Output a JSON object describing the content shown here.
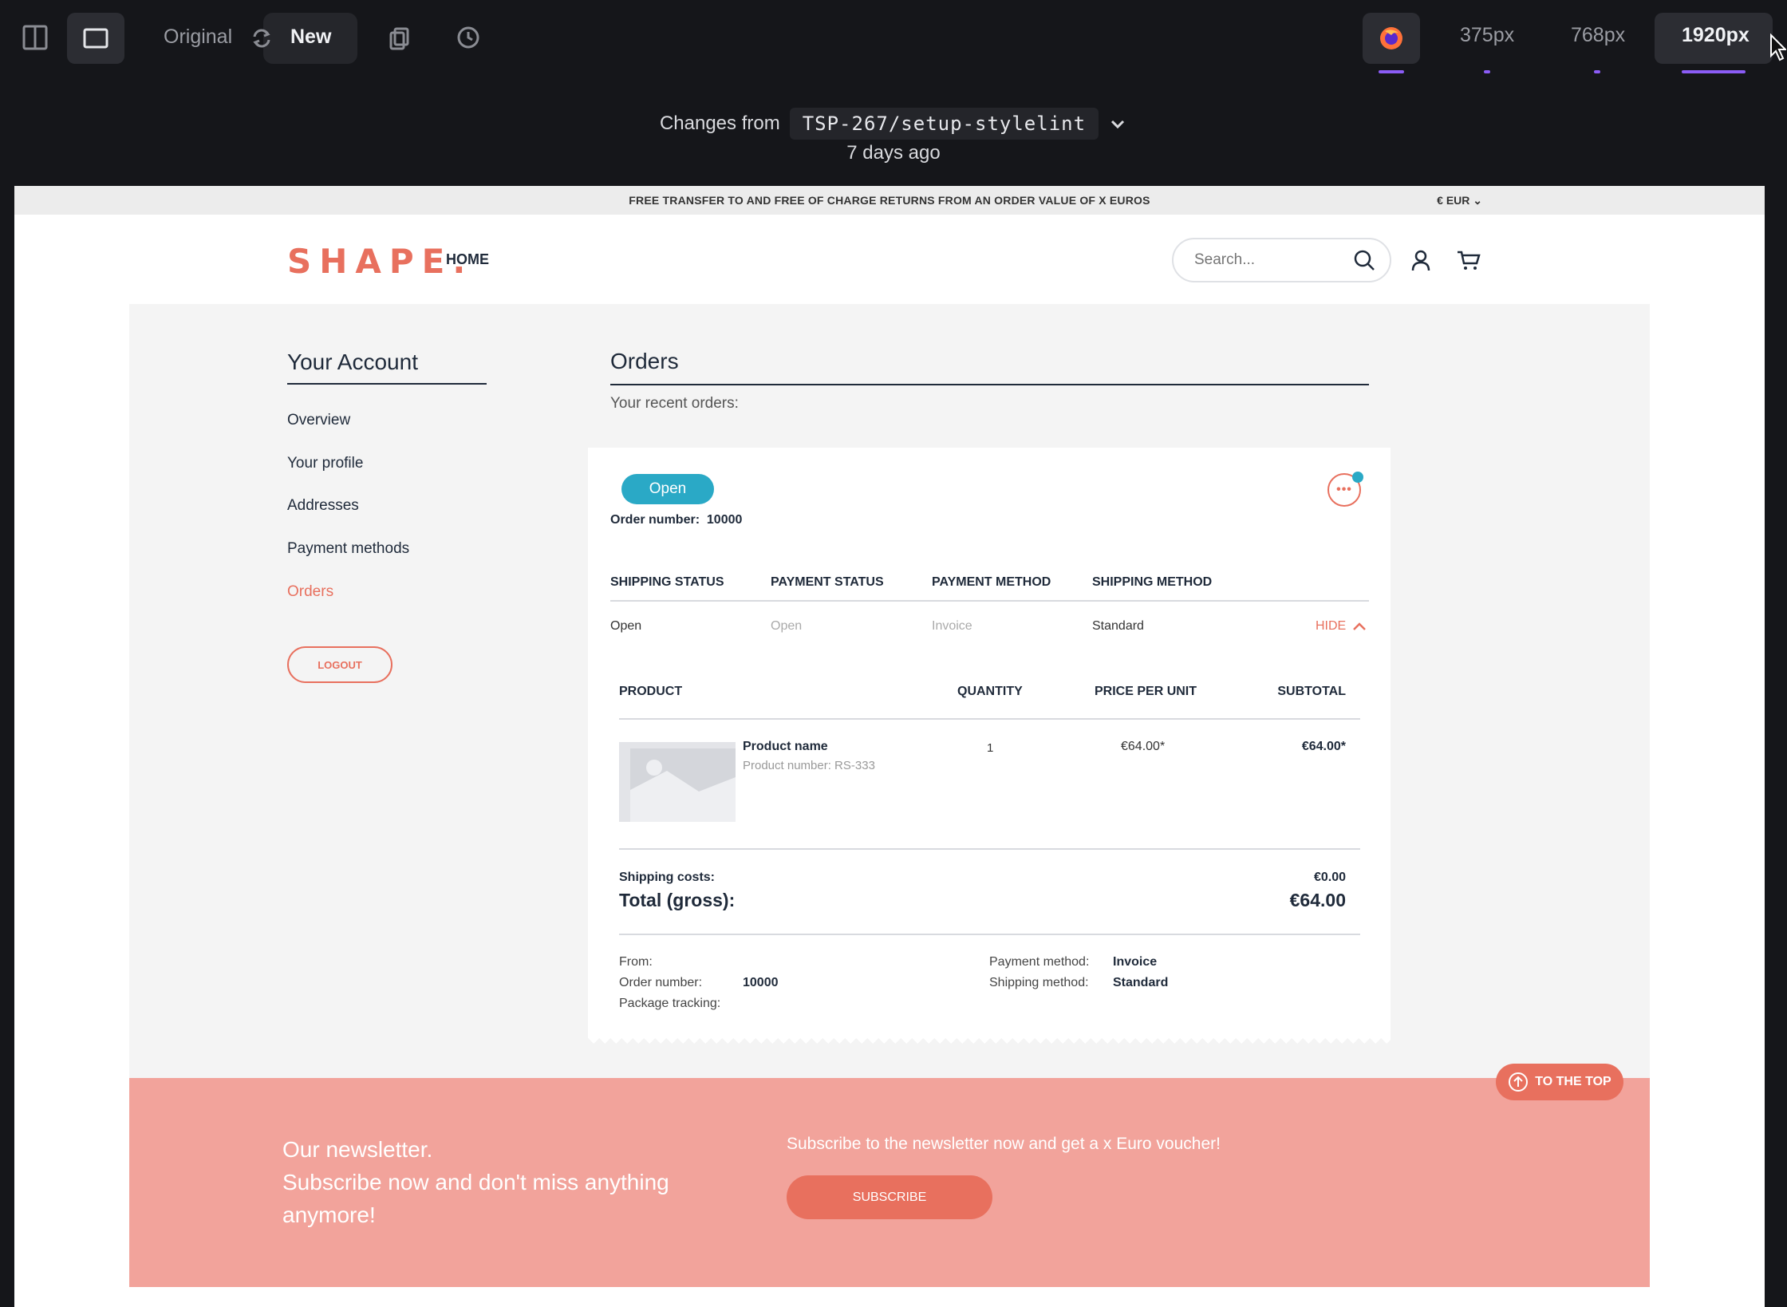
{
  "toolbar": {
    "original_label": "Original",
    "new_label": "New",
    "sizes": [
      "375px",
      "768px",
      "1920px"
    ],
    "accent_color": "#8b5cf6"
  },
  "diff": {
    "changes_from_label": "Changes from",
    "branch": "TSP-267/setup-stylelint",
    "time_ago": "7 days ago"
  },
  "page": {
    "announcement": "FREE TRANSFER TO AND FREE OF CHARGE RETURNS FROM AN ORDER VALUE OF X EUROS",
    "currency": "€ EUR ⌄",
    "logo": "SHAPE.",
    "nav_home": "HOME",
    "search_placeholder": "Search...",
    "brand_color": "#e8705e",
    "status_color": "#2aa9c6"
  },
  "account": {
    "title": "Your Account",
    "links": [
      "Overview",
      "Your profile",
      "Addresses",
      "Payment methods",
      "Orders"
    ],
    "logout": "LOGOUT"
  },
  "orders": {
    "title": "Orders",
    "recent_label": "Your recent orders:",
    "status_badge": "Open",
    "order_number_label": "Order number:",
    "order_number": "10000",
    "status_headers": [
      "SHIPPING STATUS",
      "PAYMENT STATUS",
      "PAYMENT METHOD",
      "SHIPPING METHOD"
    ],
    "status_values": [
      "Open",
      "Open",
      "Invoice",
      "Standard"
    ],
    "hide_label": "HIDE",
    "product_headers": [
      "PRODUCT",
      "QUANTITY",
      "PRICE PER UNIT",
      "SUBTOTAL"
    ],
    "product": {
      "name": "Product name",
      "number": "Product number: RS-333",
      "quantity": "1",
      "price": "€64.00*",
      "subtotal": "€64.00*"
    },
    "shipping_costs_label": "Shipping costs:",
    "shipping_costs": "€0.00",
    "total_label": "Total (gross):",
    "total": "€64.00",
    "meta": {
      "from_label": "From:",
      "order_number_label": "Order number:",
      "order_number": "10000",
      "package_tracking_label": "Package tracking:",
      "payment_method_label": "Payment method:",
      "payment_method": "Invoice",
      "shipping_method_label": "Shipping method:",
      "shipping_method": "Standard"
    }
  },
  "newsletter": {
    "title": "Our newsletter.\nSubscribe now and don't miss anything anymore!",
    "subtitle": "Subscribe to the newsletter now and get a x Euro voucher!",
    "subscribe": "SUBSCRIBE",
    "to_top": "TO THE TOP"
  }
}
